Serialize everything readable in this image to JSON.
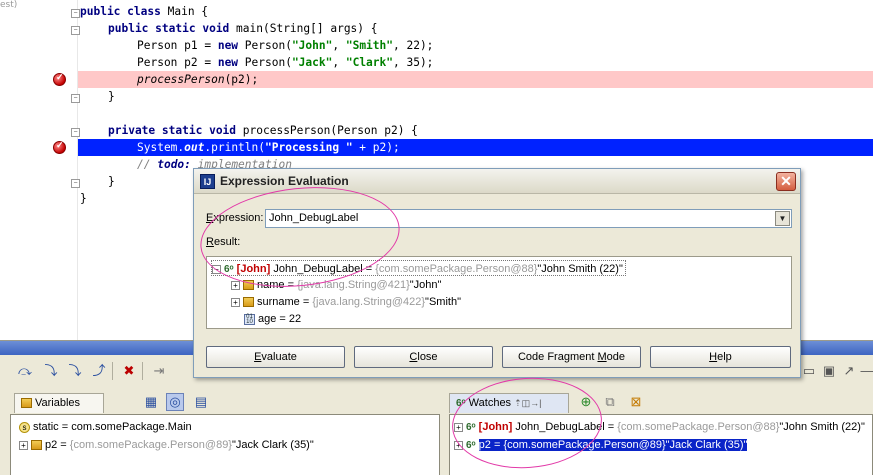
{
  "gutter_top_text": "est)",
  "code": {
    "line_class": [
      "public",
      "class",
      "Main {"
    ],
    "line_main": [
      "public",
      "static",
      "void",
      "main(String[] args) {"
    ],
    "line_p1": {
      "pre": "Person p1 = ",
      "kw": "new",
      "call": " Person(",
      "s1": "\"John\"",
      "sep1": ", ",
      "s2": "\"Smith\"",
      "rest": ", 22);"
    },
    "line_p2": {
      "pre": "Person p2 = ",
      "kw": "new",
      "call": " Person(",
      "s1": "\"Jack\"",
      "sep1": ", ",
      "s2": "\"Clark\"",
      "rest": ", 35);"
    },
    "line_call": {
      "name": "processPerson",
      "rest": "(p2);"
    },
    "line_close1": "}",
    "line_private": [
      "private",
      "static",
      "void",
      "processPerson(Person p2) {"
    ],
    "line_sysout": {
      "pre": "System.",
      "out": "out",
      "mid": ".println(",
      "str": "\"Processing \"",
      "rest": " + p2);"
    },
    "line_todo": {
      "slashes": "// ",
      "todo": "todo:",
      "rest": " implementation"
    },
    "line_close2": "}",
    "line_close3": "}"
  },
  "dialog": {
    "title": "Expression Evaluation",
    "icon": "intellij-icon",
    "expression_label_u": "E",
    "expression_label_rest": "xpression:",
    "expression_value": "John_DebugLabel",
    "result_label_u": "R",
    "result_label_rest": "esult:",
    "result_tree": {
      "root": {
        "tag": "[John]",
        "name": "John_DebugLabel = ",
        "type": "{com.somePackage.Person@88}",
        "value": "\"John Smith (22)\""
      },
      "children": [
        {
          "name": "name = ",
          "type": "{java.lang.String@421}",
          "value": "\"John\"",
          "icon": "field-icon"
        },
        {
          "name": "surname = ",
          "type": "{java.lang.String@422}",
          "value": "\"Smith\"",
          "icon": "field-icon"
        },
        {
          "name": "age = 22",
          "type": "",
          "value": "",
          "icon": "primitive-icon"
        }
      ]
    },
    "buttons": {
      "evaluate": {
        "u": "E",
        "rest": "valuate"
      },
      "close": {
        "u": "C",
        "rest": "lose"
      },
      "code_fragment": {
        "pre": "Code Fragment ",
        "u": "M",
        "rest": "ode"
      },
      "help": {
        "u": "H",
        "rest": "elp"
      }
    }
  },
  "variables": {
    "tab": "Variables",
    "items": [
      {
        "name": "static = com.somePackage.Main",
        "type": "",
        "value": "",
        "icon": "static-icon"
      },
      {
        "name": "p2 = ",
        "type": "{com.somePackage.Person@89}",
        "value": "\"Jack Clark (35)\"",
        "icon": "field-icon"
      }
    ]
  },
  "watches": {
    "tab": "Watches",
    "items": [
      {
        "tag": "[John]",
        "name": "John_DebugLabel = ",
        "type": "{com.somePackage.Person@88}",
        "value": "\"John Smith (22)\""
      },
      {
        "tag": "",
        "name": "p2 = ",
        "type": "{com.somePackage.Person@89}",
        "value": "\"Jack Clark (35)\"",
        "selected": true
      }
    ]
  },
  "colors": {
    "keyword": "#000080",
    "string": "#008000",
    "breakpoint_line": "#ffc8c8",
    "execution_line": "#0022ff",
    "annotation_ring": "#e23aa8",
    "label_tag": "#c00000"
  }
}
